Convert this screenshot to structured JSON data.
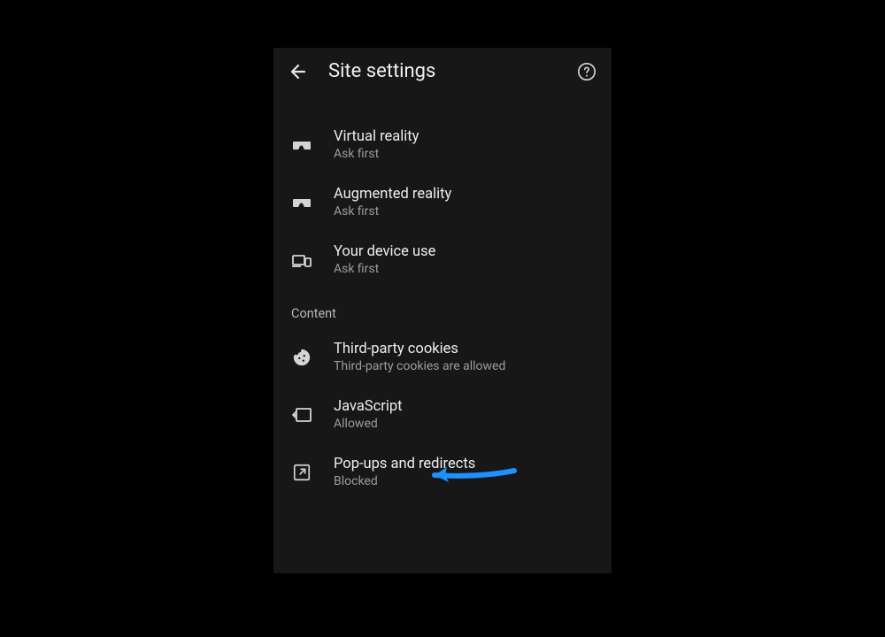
{
  "header": {
    "title": "Site settings"
  },
  "settings": [
    {
      "label": "Virtual reality",
      "status": "Ask first"
    },
    {
      "label": "Augmented reality",
      "status": "Ask first"
    },
    {
      "label": "Your device use",
      "status": "Ask first"
    }
  ],
  "section_content_label": "Content",
  "content_settings": [
    {
      "label": "Third-party cookies",
      "status": "Third-party cookies are allowed"
    },
    {
      "label": "JavaScript",
      "status": "Allowed"
    },
    {
      "label": "Pop-ups and redirects",
      "status": "Blocked"
    }
  ],
  "annotation": {
    "color": "#1e90ff"
  }
}
